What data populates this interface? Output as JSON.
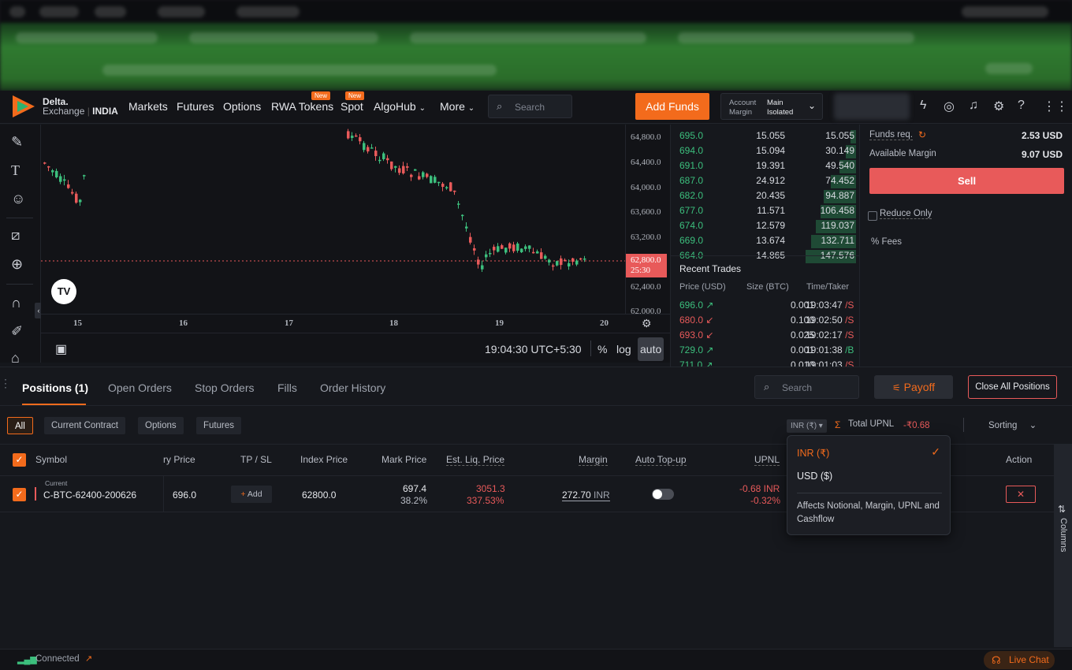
{
  "brand": {
    "name": "Delta.",
    "sub": "Exchange",
    "region": "INDIA"
  },
  "nav": {
    "items": [
      "Markets",
      "Futures",
      "Options",
      "RWA Tokens",
      "Spot",
      "AlgoHub",
      "More"
    ],
    "new_badge": "New",
    "search_placeholder": "Search",
    "add_funds": "Add Funds",
    "account_label1": "Account",
    "account_label2": "Margin",
    "account_value1": "Main",
    "account_value2": "Isolated"
  },
  "chart": {
    "price_labels": [
      "64,800.0",
      "64,400.0",
      "64,000.0",
      "63,600.0",
      "63,200.0",
      "62,800.0",
      "62,400.0",
      "62,000.0"
    ],
    "current_price": "62,800.0",
    "countdown": "25:30",
    "x_labels": [
      "15",
      "16",
      "17",
      "18",
      "19",
      "20"
    ],
    "time": "19:04:30 UTC+5:30",
    "pct": "%",
    "log": "log",
    "auto": "auto",
    "colors": {
      "up": "#3cbf7d",
      "down": "#e85a5a"
    }
  },
  "orderbook": {
    "rows": [
      {
        "price": "695.0",
        "size": "15.055",
        "cum": "15.055",
        "depth": 0.11
      },
      {
        "price": "694.0",
        "size": "15.094",
        "cum": "30.149",
        "depth": 0.2
      },
      {
        "price": "691.0",
        "size": "19.391",
        "cum": "49.540",
        "depth": 0.33
      },
      {
        "price": "687.0",
        "size": "24.912",
        "cum": "74.452",
        "depth": 0.49
      },
      {
        "price": "682.0",
        "size": "20.435",
        "cum": "94.887",
        "depth": 0.63
      },
      {
        "price": "677.0",
        "size": "11.571",
        "cum": "106.458",
        "depth": 0.7
      },
      {
        "price": "674.0",
        "size": "12.579",
        "cum": "119.037",
        "depth": 0.79
      },
      {
        "price": "669.0",
        "size": "13.674",
        "cum": "132.711",
        "depth": 0.88
      },
      {
        "price": "664.0",
        "size": "14.865",
        "cum": "147.576",
        "depth": 0.98
      }
    ]
  },
  "trades": {
    "title": "Recent Trades",
    "col_price": "Price (USD)",
    "col_size": "Size (BTC)",
    "col_time": "Time/Taker",
    "rows": [
      {
        "price": "696.0",
        "dir": "up",
        "size": "0.001",
        "time": "19:03:47",
        "taker": "/S"
      },
      {
        "price": "680.0",
        "dir": "down",
        "size": "0.100",
        "time": "19:02:50",
        "taker": "/S"
      },
      {
        "price": "693.0",
        "dir": "down",
        "size": "0.025",
        "time": "19:02:17",
        "taker": "/S"
      },
      {
        "price": "729.0",
        "dir": "up",
        "size": "0.001",
        "time": "19:01:38",
        "taker": "/B"
      },
      {
        "price": "711.0",
        "dir": "up",
        "size": "0.010",
        "time": "19:01:03",
        "taker": "/S"
      }
    ]
  },
  "orderform": {
    "funds_req_label": "Funds req.",
    "funds_req_value": "2.53 USD",
    "avail_label": "Available Margin",
    "avail_value": "9.07 USD",
    "sell": "Sell",
    "reduce_only": "Reduce Only",
    "fees": "Fees"
  },
  "positions": {
    "tabs": [
      "Positions (1)",
      "Open Orders",
      "Stop Orders",
      "Fills",
      "Order History"
    ],
    "search_placeholder": "Search",
    "payoff": "Payoff",
    "close_all": "Close All Positions",
    "filters": [
      "All",
      "Current Contract",
      "Options",
      "Futures"
    ],
    "currency": "INR (₹)",
    "total_upnl_label": "Total UPNL",
    "total_upnl_value": "-₹0.68",
    "sorting": "Sorting",
    "columns_label": "Columns",
    "headers": {
      "symbol": "Symbol",
      "entry": "ry Price",
      "tpsl": "TP / SL",
      "index": "Index Price",
      "mark": "Mark Price",
      "liq": "Est. Liq. Price",
      "margin": "Margin",
      "autotopup": "Auto Top-up",
      "upnl": "UPNL",
      "action": "Action"
    },
    "row": {
      "tag": "Current",
      "symbol": "C-BTC-62400-200626",
      "entry": "696.0",
      "add": "Add",
      "index": "62800.0",
      "mark": "697.4",
      "mark_pct": "38.2%",
      "liq": "3051.3",
      "liq_pct": "337.53%",
      "margin": "272.70",
      "margin_unit": "INR",
      "auto_topup_on": false,
      "upnl": "-0.68 INR",
      "upnl_pct": "-0.32%"
    }
  },
  "dropdown": {
    "options": [
      "INR (₹)",
      "USD ($)"
    ],
    "selected": "INR (₹)",
    "note": "Affects Notional, Margin, UPNL and Cashflow"
  },
  "status": {
    "connected": "Connected",
    "live_chat": "Live Chat"
  }
}
